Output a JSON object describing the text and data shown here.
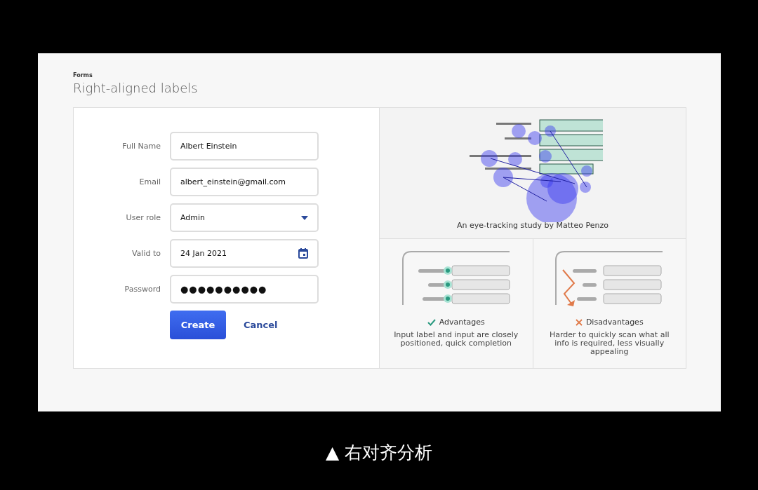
{
  "section": "Forms",
  "title": "Right-aligned labels",
  "form": {
    "fields": [
      {
        "label": "Full Name",
        "kind": "text",
        "value": "Albert Einstein"
      },
      {
        "label": "Email",
        "kind": "text",
        "value": "albert_einstein@gmail.com"
      },
      {
        "label": "User role",
        "kind": "select",
        "value": "Admin"
      },
      {
        "label": "Valid to",
        "kind": "date",
        "value": "24 Jan 2021"
      },
      {
        "label": "Password",
        "kind": "password",
        "value": "●●●●●●●●●●"
      }
    ],
    "primary_button": "Create",
    "secondary_link": "Cancel"
  },
  "study": {
    "caption": "An eye-tracking study by Matteo Penzo"
  },
  "verdicts": [
    {
      "kind": "pro",
      "heading": "Advantages",
      "text": "Input label and input are closely positioned, quick completion"
    },
    {
      "kind": "con",
      "heading": "Disadvantages",
      "text": "Harder to quickly scan what all info is required, less visually appealing"
    }
  ],
  "caption": "▲ 右对齐分析"
}
